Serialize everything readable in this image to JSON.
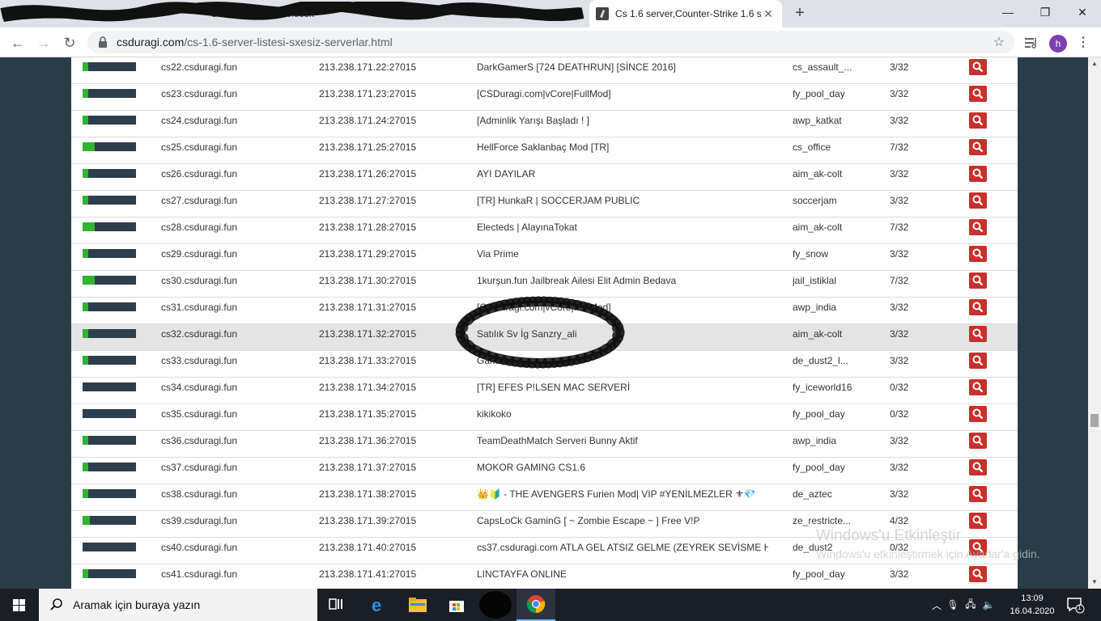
{
  "browser": {
    "active_tab_title": "Cs 1.6 server,Counter-Strike 1.6 s",
    "inactive_tab_title": "CSDuragi Fakli Gelecek",
    "new_tab_symbol": "+",
    "url_domain": "csduragi.com",
    "url_path": "/cs-1.6-server-listesi-sxesiz-serverlar.html",
    "profile_initial": "h"
  },
  "servers": [
    {
      "fill": 0.1,
      "host": "cs22.csduragi.fun",
      "ip": "213.238.171.22:27015",
      "name": "DarkGamerS [724 DEATHRUN] [SİNCE 2016]",
      "map": "cs_assault_...",
      "players": "3/32"
    },
    {
      "fill": 0.1,
      "host": "cs23.csduragi.fun",
      "ip": "213.238.171.23:27015",
      "name": "[CSDuragi.com|vCore|FullMod]",
      "map": "fy_pool_day",
      "players": "3/32"
    },
    {
      "fill": 0.1,
      "host": "cs24.csduragi.fun",
      "ip": "213.238.171.24:27015",
      "name": "[Adminlik Yarışı Başladı ! ]",
      "map": "awp_katkat",
      "players": "3/32"
    },
    {
      "fill": 0.22,
      "host": "cs25.csduragi.fun",
      "ip": "213.238.171.25:27015",
      "name": "HellForce Saklanbaç Mod [TR]",
      "map": "cs_office",
      "players": "7/32"
    },
    {
      "fill": 0.1,
      "host": "cs26.csduragi.fun",
      "ip": "213.238.171.26:27015",
      "name": "AYI DAYILAR",
      "map": "aim_ak-colt",
      "players": "3/32"
    },
    {
      "fill": 0.1,
      "host": "cs27.csduragi.fun",
      "ip": "213.238.171.27:27015",
      "name": "[TR] HunkaR | SOCCERJAM PUBLIC",
      "map": "soccerjam",
      "players": "3/32"
    },
    {
      "fill": 0.22,
      "host": "cs28.csduragi.fun",
      "ip": "213.238.171.28:27015",
      "name": "Electeds | AlayınaTokat",
      "map": "aim_ak-colt",
      "players": "7/32"
    },
    {
      "fill": 0.1,
      "host": "cs29.csduragi.fun",
      "ip": "213.238.171.29:27015",
      "name": "Via Prime",
      "map": "fy_snow",
      "players": "3/32"
    },
    {
      "fill": 0.22,
      "host": "cs30.csduragi.fun",
      "ip": "213.238.171.30:27015",
      "name": "1kurşun.fun Jailbreak Ailesi Elit Admin Bedava",
      "map": "jail_istiklal",
      "players": "7/32"
    },
    {
      "fill": 0.1,
      "host": "cs31.csduragi.fun",
      "ip": "213.238.171.31:27015",
      "name": "[CSDuragi.com|vCore|FullMod]",
      "map": "awp_india",
      "players": "3/32"
    },
    {
      "fill": 0.1,
      "host": "cs32.csduragi.fun",
      "ip": "213.238.171.32:27015",
      "name": "Satılık Sv İg Sanzry_ali",
      "map": "aim_ak-colt",
      "players": "3/32"
    },
    {
      "fill": 0.1,
      "host": "cs33.csduragi.fun",
      "ip": "213.238.171.33:27015",
      "name": "Game Club",
      "map": "de_dust2_l...",
      "players": "3/32"
    },
    {
      "fill": 0,
      "host": "cs34.csduragi.fun",
      "ip": "213.238.171.34:27015",
      "name": "[TR] EFES P!LSEN MAC SERVERİ",
      "map": "fy_iceworld16",
      "players": "0/32"
    },
    {
      "fill": 0,
      "host": "cs35.csduragi.fun",
      "ip": "213.238.171.35:27015",
      "name": "kikikoko",
      "map": "fy_pool_day",
      "players": "0/32"
    },
    {
      "fill": 0.1,
      "host": "cs36.csduragi.fun",
      "ip": "213.238.171.36:27015",
      "name": "TeamDeathMatch Serveri Bunny Aktif",
      "map": "awp_india",
      "players": "3/32"
    },
    {
      "fill": 0.1,
      "host": "cs37.csduragi.fun",
      "ip": "213.238.171.37:27015",
      "name": "MOKOR GAMING CS1.6",
      "map": "fy_pool_day",
      "players": "3/32"
    },
    {
      "fill": 0.1,
      "host": "cs38.csduragi.fun",
      "ip": "213.238.171.38:27015",
      "name": "👑🔰 - THE AVENGERS Furien Mod| VIP #YENİLMEZLER ⚜💎",
      "map": "de_aztec",
      "players": "3/32"
    },
    {
      "fill": 0.13,
      "host": "cs39.csduragi.fun",
      "ip": "213.238.171.39:27015",
      "name": "CapsLoCk GaminG [ ~ Zombie Escape ~ ] Free V!P",
      "map": "ze_restricte...",
      "players": "4/32"
    },
    {
      "fill": 0,
      "host": "cs40.csduragi.fun",
      "ip": "213.238.171.40:27015",
      "name": "cs37.csduragi.com ATLA GEL ATSIZ GELME (ZEYREK SEVİSME HIZMET...",
      "map": "de_dust2",
      "players": "0/32"
    },
    {
      "fill": 0.1,
      "host": "cs41.csduragi.fun",
      "ip": "213.238.171.41:27015",
      "name": "LINCTAYFA ONLINE",
      "map": "fy_pool_day",
      "players": "3/32"
    }
  ],
  "highlighted_row": 10,
  "colors": {
    "accent": "#c9302c",
    "bar_bg": "#2d3e4d",
    "bar_fill": "#2fb52f",
    "page_bg": "#293d47"
  },
  "watermark": {
    "title": "Windows'u Etkinleştir",
    "subtitle": "Windows'u etkinleştirmek için Ayarlar'a gidin."
  },
  "taskbar": {
    "search_placeholder": "Aramak için buraya yazın",
    "time": "13:09",
    "date": "16.04.2020",
    "notification_count": "1"
  }
}
